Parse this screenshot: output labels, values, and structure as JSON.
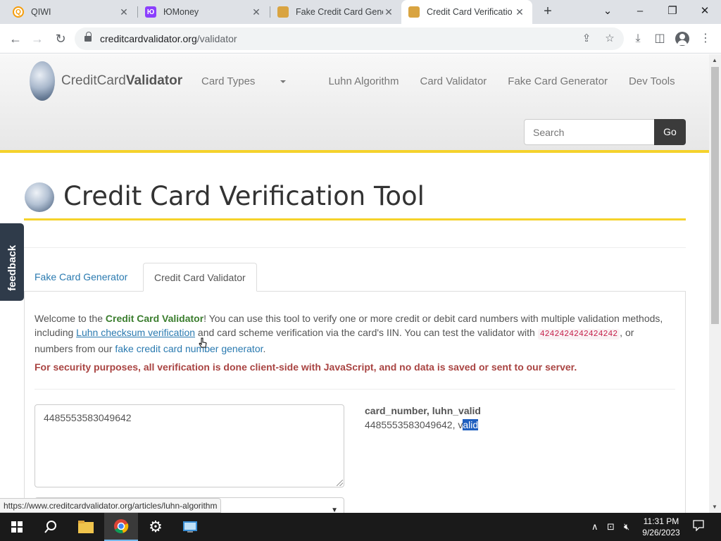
{
  "browser": {
    "tabs": [
      {
        "title": "QIWI",
        "favicon_color": "#f59d0b",
        "favicon_glyph": "Q"
      },
      {
        "title": "ЮMoney",
        "favicon_color": "#8b3ffd",
        "favicon_glyph": "Ю"
      },
      {
        "title": "Fake Credit Card Gene",
        "favicon_color": "#d9a441",
        "favicon_glyph": "▦"
      },
      {
        "title": "Credit Card Verificatio",
        "favicon_color": "#d9a441",
        "favicon_glyph": "▦"
      }
    ],
    "address": {
      "host": "creditcardvalidator.org",
      "path": "/validator"
    }
  },
  "site": {
    "logo_prefix": "CreditCard",
    "logo_bold": "Validator",
    "nav": [
      "Card Types",
      "Luhn Algorithm",
      "Card Validator",
      "Fake Card Generator",
      "Dev Tools"
    ],
    "search_placeholder": "Search",
    "go_label": "Go"
  },
  "page": {
    "title": "Credit Card Verification Tool",
    "tabs": [
      "Fake Card Generator",
      "Credit Card Validator"
    ],
    "intro": {
      "p1": "Welcome to the ",
      "p1_bold": "Credit Card Validator",
      "p2": "! You can use this tool to verify one or more credit or debit card numbers with multiple validation methods, including ",
      "link1": "Luhn checksum verification",
      "p3": " and card scheme verification via the card's IIN. You can test the validator with ",
      "test_number": "4242424242424242",
      "p4": ", or numbers from our ",
      "link2": "fake credit card number generator",
      "p5": "."
    },
    "security_note": "For security purposes, all verification is done client-side with JavaScript, and no data is saved or sent to our server.",
    "card_input_value": "4485553583049642",
    "results_header": "card_number, luhn_valid",
    "result_number": "4485553583049642, v",
    "result_highlight": "alid"
  },
  "feedback_label": "feedback",
  "status_url": "https://www.creditcardvalidator.org/articles/luhn-algorithm",
  "taskbar": {
    "time": "11:31 PM",
    "date": "9/26/2023"
  }
}
